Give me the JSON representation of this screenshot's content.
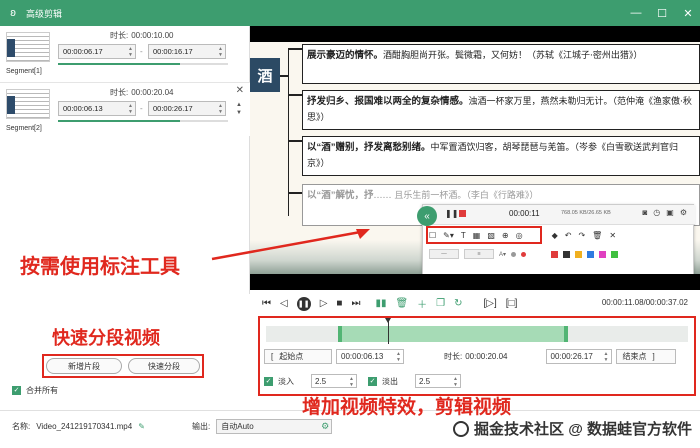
{
  "window": {
    "title": "高级剪辑"
  },
  "segments": [
    {
      "label": "Segment[1]",
      "duration_label": "时长:",
      "duration": "00:00:10.00",
      "start": "00:00:06.17",
      "end": "00:00:16.17",
      "progress": 0.72
    },
    {
      "label": "Segment[2]",
      "duration_label": "时长:",
      "duration": "00:00:20.04",
      "start": "00:00:06.13",
      "end": "00:00:26.17",
      "progress": 0.72
    }
  ],
  "slide": {
    "badge": "酒",
    "lines": [
      {
        "bold": "展示豪迈的情怀。",
        "rest": "酒酣胸胆尚开张。鬓微霜，又何妨！（苏轼《江城子·密州出猎》）"
      },
      {
        "bold": "抒发归乡、报国难以两全的复杂情感。",
        "rest": "浊酒一杯家万里，燕然未勒归无计。（范仲淹《渔家傲·秋思》）"
      },
      {
        "bold": "以“酒”赠别，抒发离愁别绪。",
        "rest": "中军置酒饮归客，胡琴琵琶与羌笛。（岑参《白雪歌送武判官归京》）"
      },
      {
        "bold": "以“酒”解忧，抒",
        "rest": "…… 且乐生前一杯酒。（李白《行路难》）"
      }
    ]
  },
  "annotation_toolbar": {
    "time": "00:00:11",
    "info": "768.05 KB/26.65 KB"
  },
  "playback": {
    "time": "00:00:11.08/00:00:37.02",
    "progress": 0.3
  },
  "edit": {
    "start_btn": "起始点",
    "start": "00:00:06.13",
    "duration_label": "时长:",
    "duration": "00:00:20.04",
    "end": "00:00:26.17",
    "end_btn": "结束点",
    "fade_in_label": "淡入",
    "fade_in": "2.5",
    "fade_out_label": "淡出",
    "fade_out": "2.5"
  },
  "buttons": {
    "add_segment": "新增片段",
    "quick_split": "快速分段",
    "merge_all": "合并所有"
  },
  "footer": {
    "name_label": "名称:",
    "filename": "Video_241219170341.mp4",
    "output_label": "输出:",
    "output_value": "自动Auto"
  },
  "callouts": {
    "annotate": "按需使用标注工具",
    "split": "快速分段视频",
    "effects": "增加视频特效，剪辑视频"
  },
  "watermark": "掘金技术社区 @ 数据蛙官方软件"
}
